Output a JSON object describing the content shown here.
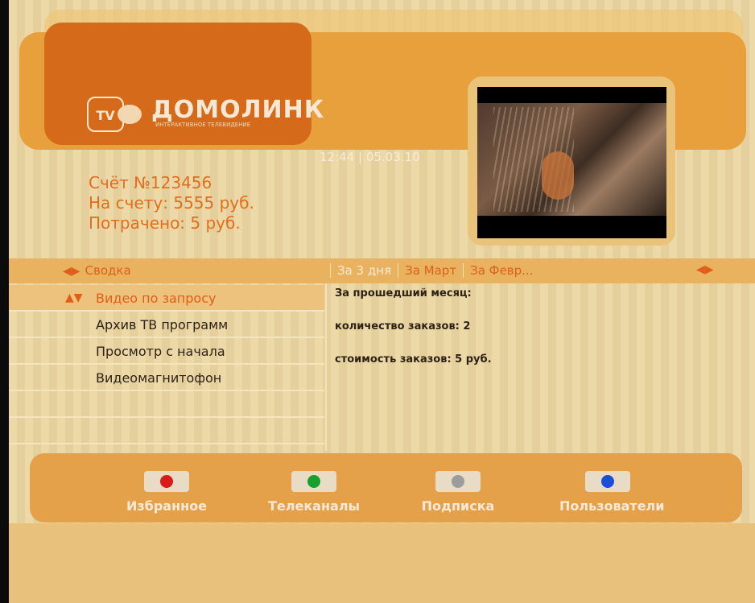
{
  "header": {
    "logo_tv": "TV",
    "brand_name": "ДОМОЛИНК",
    "brand_tagline": "ИНТЕРАКТИВНОЕ ТЕЛЕВИДЕНИЕ",
    "clock": "12:44 | 05.03.10"
  },
  "account": {
    "number": "Счёт №123456",
    "balance": "На счету: 5555 руб.",
    "spent": "Потрачено: 5 руб."
  },
  "tabs": {
    "summary_label": "Сводка",
    "periods": [
      "За 3 дня",
      "За Март",
      "За Февр..."
    ]
  },
  "menu": {
    "items": [
      {
        "label": "Видео по запросу",
        "selected": true
      },
      {
        "label": "Архив ТВ программ",
        "selected": false
      },
      {
        "label": "Просмотр с начала",
        "selected": false
      },
      {
        "label": "Видеомагнитофон",
        "selected": false
      }
    ]
  },
  "stats": {
    "period": "За прошедший месяц:",
    "orders_count": "количество заказов: 2",
    "orders_cost": "стоимость заказов: 5 руб."
  },
  "footer": {
    "buttons": [
      {
        "label": "Избранное",
        "color": "#d81c1c"
      },
      {
        "label": "Телеканалы",
        "color": "#18a02c"
      },
      {
        "label": "Подписка",
        "color": "#9c9c9c"
      },
      {
        "label": "Пользователи",
        "color": "#1a4fd6"
      }
    ]
  },
  "colors": {
    "accent": "#e05f18",
    "header_dark": "#d56b1a",
    "header_band": "#e8a03d",
    "background": "#ecd7a2"
  }
}
